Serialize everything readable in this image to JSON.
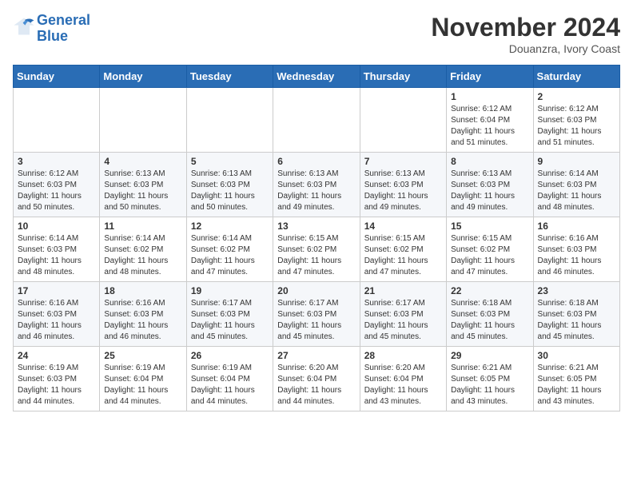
{
  "logo": {
    "line1": "General",
    "line2": "Blue"
  },
  "header": {
    "month": "November 2024",
    "location": "Douanzra, Ivory Coast"
  },
  "weekdays": [
    "Sunday",
    "Monday",
    "Tuesday",
    "Wednesday",
    "Thursday",
    "Friday",
    "Saturday"
  ],
  "weeks": [
    [
      {
        "day": "",
        "info": ""
      },
      {
        "day": "",
        "info": ""
      },
      {
        "day": "",
        "info": ""
      },
      {
        "day": "",
        "info": ""
      },
      {
        "day": "",
        "info": ""
      },
      {
        "day": "1",
        "info": "Sunrise: 6:12 AM\nSunset: 6:04 PM\nDaylight: 11 hours\nand 51 minutes."
      },
      {
        "day": "2",
        "info": "Sunrise: 6:12 AM\nSunset: 6:03 PM\nDaylight: 11 hours\nand 51 minutes."
      }
    ],
    [
      {
        "day": "3",
        "info": "Sunrise: 6:12 AM\nSunset: 6:03 PM\nDaylight: 11 hours\nand 50 minutes."
      },
      {
        "day": "4",
        "info": "Sunrise: 6:13 AM\nSunset: 6:03 PM\nDaylight: 11 hours\nand 50 minutes."
      },
      {
        "day": "5",
        "info": "Sunrise: 6:13 AM\nSunset: 6:03 PM\nDaylight: 11 hours\nand 50 minutes."
      },
      {
        "day": "6",
        "info": "Sunrise: 6:13 AM\nSunset: 6:03 PM\nDaylight: 11 hours\nand 49 minutes."
      },
      {
        "day": "7",
        "info": "Sunrise: 6:13 AM\nSunset: 6:03 PM\nDaylight: 11 hours\nand 49 minutes."
      },
      {
        "day": "8",
        "info": "Sunrise: 6:13 AM\nSunset: 6:03 PM\nDaylight: 11 hours\nand 49 minutes."
      },
      {
        "day": "9",
        "info": "Sunrise: 6:14 AM\nSunset: 6:03 PM\nDaylight: 11 hours\nand 48 minutes."
      }
    ],
    [
      {
        "day": "10",
        "info": "Sunrise: 6:14 AM\nSunset: 6:03 PM\nDaylight: 11 hours\nand 48 minutes."
      },
      {
        "day": "11",
        "info": "Sunrise: 6:14 AM\nSunset: 6:02 PM\nDaylight: 11 hours\nand 48 minutes."
      },
      {
        "day": "12",
        "info": "Sunrise: 6:14 AM\nSunset: 6:02 PM\nDaylight: 11 hours\nand 47 minutes."
      },
      {
        "day": "13",
        "info": "Sunrise: 6:15 AM\nSunset: 6:02 PM\nDaylight: 11 hours\nand 47 minutes."
      },
      {
        "day": "14",
        "info": "Sunrise: 6:15 AM\nSunset: 6:02 PM\nDaylight: 11 hours\nand 47 minutes."
      },
      {
        "day": "15",
        "info": "Sunrise: 6:15 AM\nSunset: 6:02 PM\nDaylight: 11 hours\nand 47 minutes."
      },
      {
        "day": "16",
        "info": "Sunrise: 6:16 AM\nSunset: 6:03 PM\nDaylight: 11 hours\nand 46 minutes."
      }
    ],
    [
      {
        "day": "17",
        "info": "Sunrise: 6:16 AM\nSunset: 6:03 PM\nDaylight: 11 hours\nand 46 minutes."
      },
      {
        "day": "18",
        "info": "Sunrise: 6:16 AM\nSunset: 6:03 PM\nDaylight: 11 hours\nand 46 minutes."
      },
      {
        "day": "19",
        "info": "Sunrise: 6:17 AM\nSunset: 6:03 PM\nDaylight: 11 hours\nand 45 minutes."
      },
      {
        "day": "20",
        "info": "Sunrise: 6:17 AM\nSunset: 6:03 PM\nDaylight: 11 hours\nand 45 minutes."
      },
      {
        "day": "21",
        "info": "Sunrise: 6:17 AM\nSunset: 6:03 PM\nDaylight: 11 hours\nand 45 minutes."
      },
      {
        "day": "22",
        "info": "Sunrise: 6:18 AM\nSunset: 6:03 PM\nDaylight: 11 hours\nand 45 minutes."
      },
      {
        "day": "23",
        "info": "Sunrise: 6:18 AM\nSunset: 6:03 PM\nDaylight: 11 hours\nand 45 minutes."
      }
    ],
    [
      {
        "day": "24",
        "info": "Sunrise: 6:19 AM\nSunset: 6:03 PM\nDaylight: 11 hours\nand 44 minutes."
      },
      {
        "day": "25",
        "info": "Sunrise: 6:19 AM\nSunset: 6:04 PM\nDaylight: 11 hours\nand 44 minutes."
      },
      {
        "day": "26",
        "info": "Sunrise: 6:19 AM\nSunset: 6:04 PM\nDaylight: 11 hours\nand 44 minutes."
      },
      {
        "day": "27",
        "info": "Sunrise: 6:20 AM\nSunset: 6:04 PM\nDaylight: 11 hours\nand 44 minutes."
      },
      {
        "day": "28",
        "info": "Sunrise: 6:20 AM\nSunset: 6:04 PM\nDaylight: 11 hours\nand 43 minutes."
      },
      {
        "day": "29",
        "info": "Sunrise: 6:21 AM\nSunset: 6:05 PM\nDaylight: 11 hours\nand 43 minutes."
      },
      {
        "day": "30",
        "info": "Sunrise: 6:21 AM\nSunset: 6:05 PM\nDaylight: 11 hours\nand 43 minutes."
      }
    ]
  ]
}
